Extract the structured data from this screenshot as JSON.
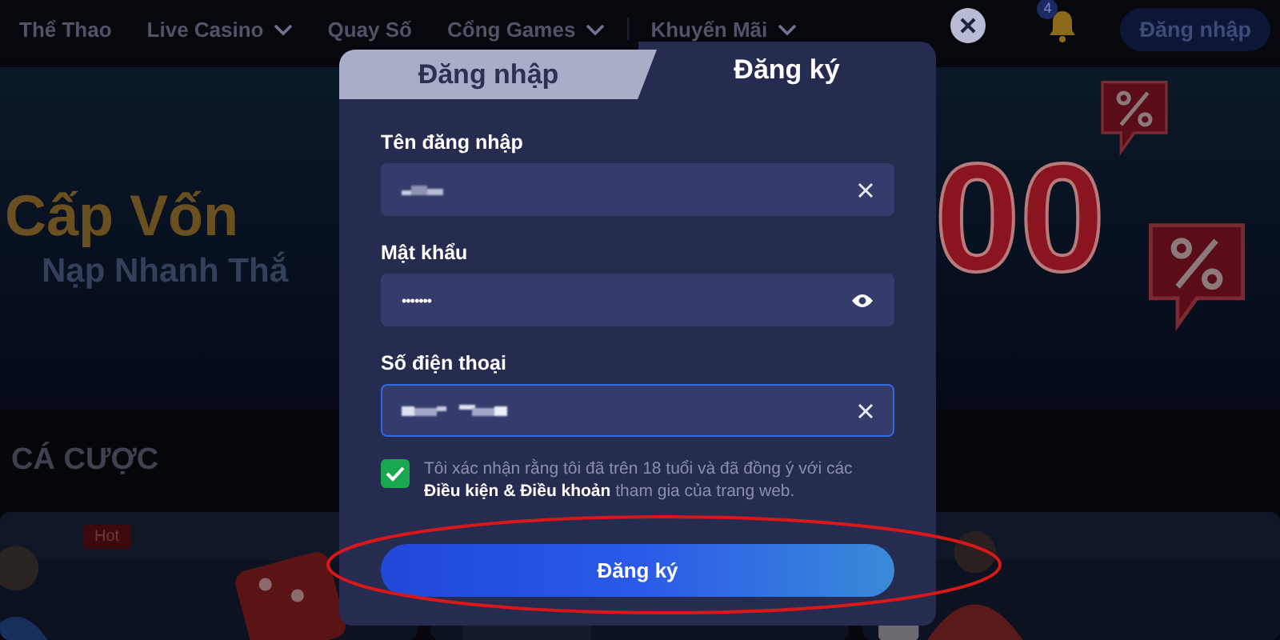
{
  "nav": {
    "items": [
      {
        "label": "Thể Thao",
        "dropdown": false
      },
      {
        "label": "Live Casino",
        "dropdown": true
      },
      {
        "label": "Quay Số",
        "dropdown": false
      },
      {
        "label": "Cổng Games",
        "dropdown": true
      },
      {
        "label": "Khuyến Mãi",
        "dropdown": true
      }
    ],
    "notification_count": "4",
    "login_button": "Đăng nhập"
  },
  "banner": {
    "headline": "Cấp Vốn",
    "subline": "Nạp Nhanh Thắ",
    "amount": "00"
  },
  "section": {
    "title": "CÁ CƯỢC",
    "cards": [
      {
        "kind": "picture",
        "badge": "Hot"
      },
      {
        "kind": "picture"
      },
      {
        "kind": "picture"
      }
    ]
  },
  "modal": {
    "tabs": [
      {
        "label": "Đăng nhập",
        "selected": false
      },
      {
        "label": "Đăng ký",
        "selected": true
      }
    ],
    "fields": [
      {
        "label": "Tên đăng nhập",
        "kind": "text",
        "redacted": true,
        "focused": false
      },
      {
        "label": "Mật khẩu",
        "kind": "password",
        "value": "•••••••",
        "focused": false
      },
      {
        "label": "Số điện thoại",
        "kind": "text",
        "redacted": true,
        "focused": true
      }
    ],
    "consent": {
      "checked": true,
      "text": "Tôi xác nhận rằng tôi đã trên 18 tuổi và đã đồng ý với các **Điều kiện & Điều khoản** tham gia của trang web."
    },
    "submit": "Đăng ký",
    "annotation": {
      "kind": "ellipse",
      "color": "#d81818"
    }
  }
}
